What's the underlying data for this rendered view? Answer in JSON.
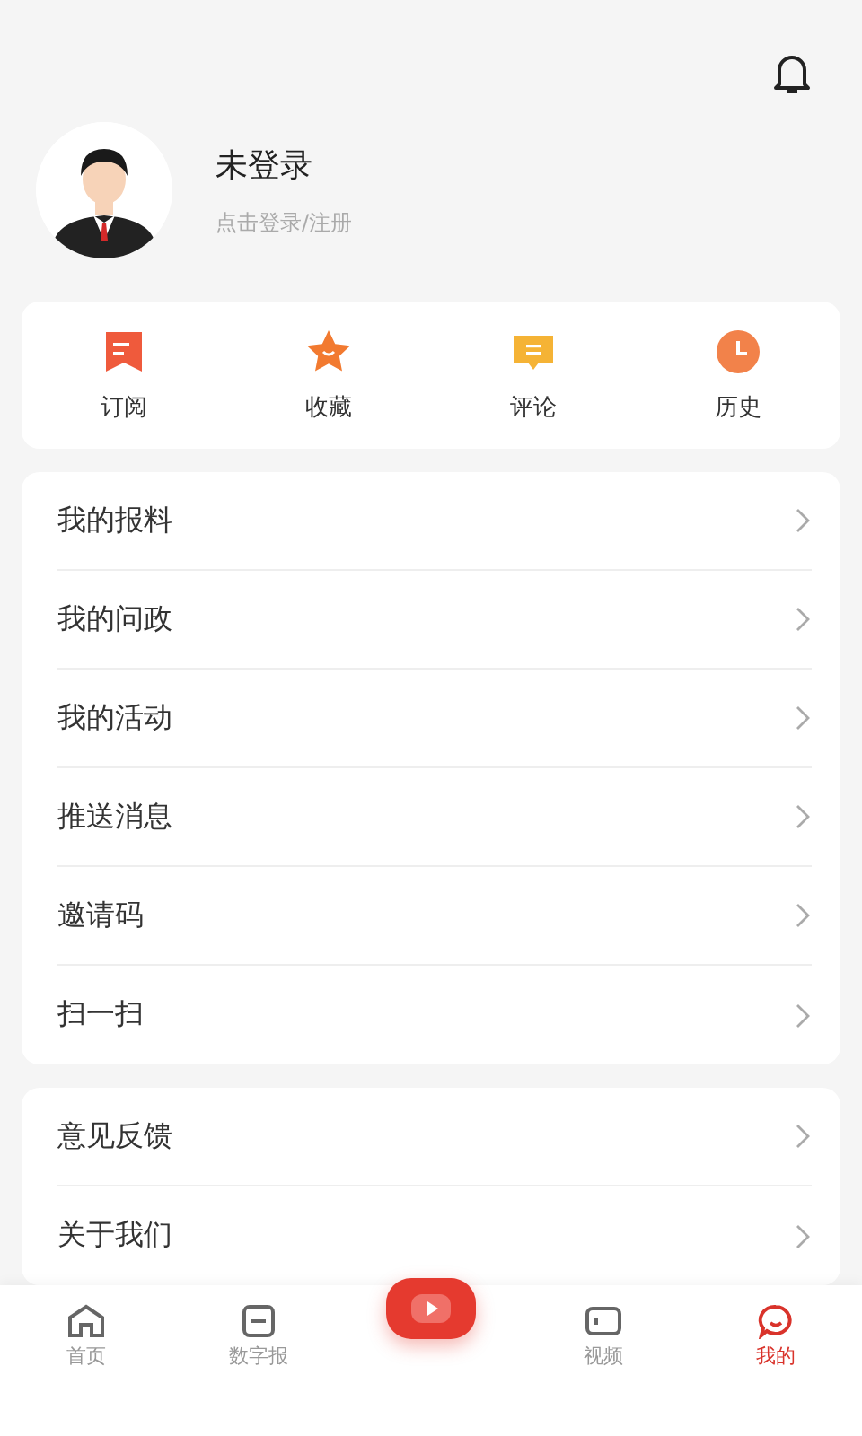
{
  "profile": {
    "name": "未登录",
    "hint": "点击登录/注册"
  },
  "shortcuts": [
    {
      "label": "订阅",
      "kind": "subscribe"
    },
    {
      "label": "收藏",
      "kind": "favorite"
    },
    {
      "label": "评论",
      "kind": "comment"
    },
    {
      "label": "历史",
      "kind": "history"
    }
  ],
  "menu_groups": [
    {
      "items": [
        "我的报料",
        "我的问政",
        "我的活动",
        "推送消息",
        "邀请码",
        "扫一扫"
      ]
    },
    {
      "items": [
        "意见反馈",
        "关于我们"
      ]
    }
  ],
  "bottom_nav": [
    {
      "label": "首页",
      "kind": "home",
      "selected": false
    },
    {
      "label": "数字报",
      "kind": "paper",
      "selected": false
    },
    {
      "kind": "center",
      "selected": false
    },
    {
      "label": "视频",
      "kind": "video",
      "selected": false
    },
    {
      "label": "我的",
      "kind": "mine",
      "selected": true
    }
  ]
}
